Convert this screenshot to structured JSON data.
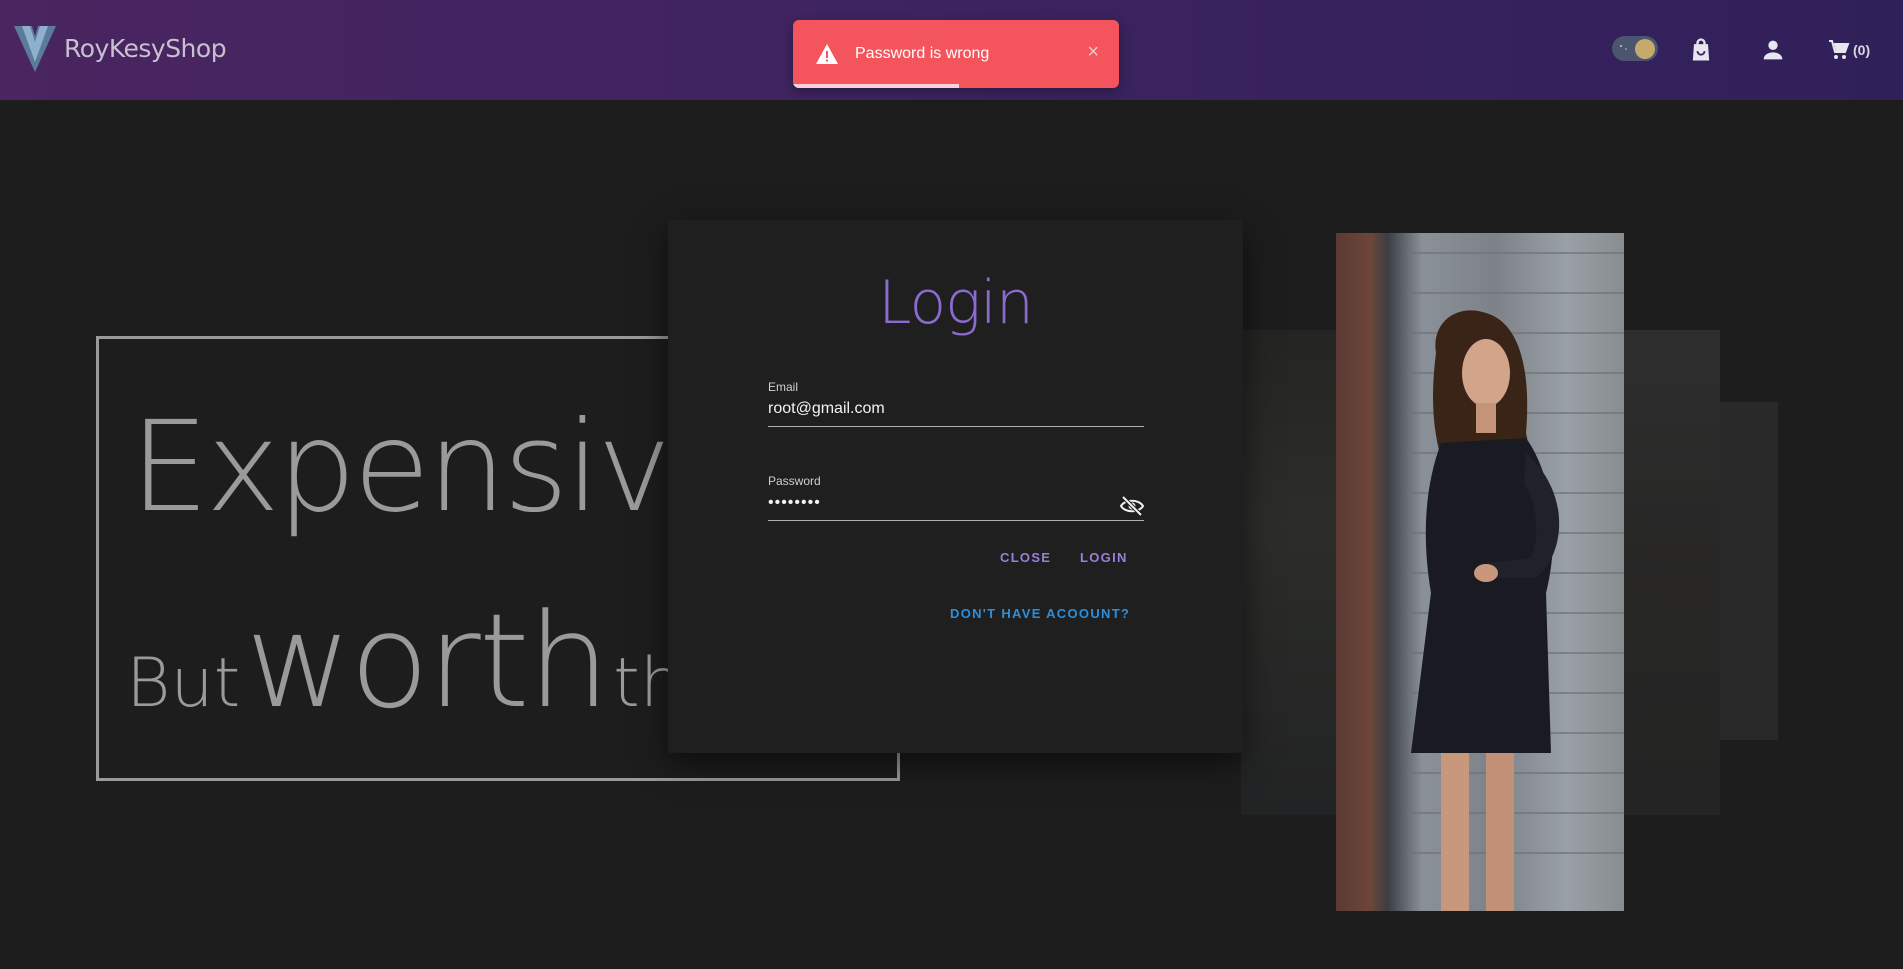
{
  "header": {
    "brand": "RoyKesyShop",
    "cart_count": "(0)",
    "icons": [
      "theme-toggle",
      "shopping-bag-icon",
      "account-icon",
      "cart-icon"
    ]
  },
  "toast": {
    "message": "Password is wrong",
    "close": "×",
    "progress_fraction": 0.51,
    "color": "#f4545b"
  },
  "hero": {
    "line1": "Expensive",
    "line2_small_a": "But",
    "line2_large": "worth",
    "line2_small_b": "the"
  },
  "login": {
    "title": "Login",
    "email_label": "Email",
    "email_value": "root@gmail.com",
    "password_label": "Password",
    "password_value": "••••••••",
    "close_label": "CLOSE",
    "login_label": "LOGIN",
    "register_label": "DON'T HAVE ACOOUNT?"
  },
  "colors": {
    "accent_purple": "#8c6bd0",
    "link_blue": "#2a8fdc",
    "background": "#1d1d1d"
  }
}
